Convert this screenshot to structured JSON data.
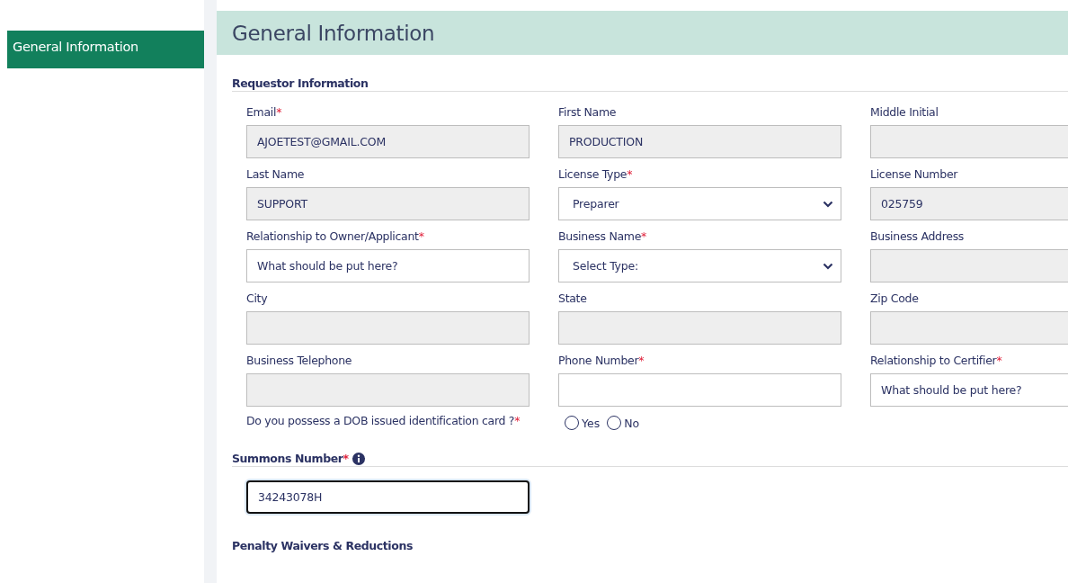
{
  "sidebar": {
    "items": [
      {
        "label": "General Information",
        "selected": true
      }
    ]
  },
  "header": {
    "title": "General Information"
  },
  "requestor": {
    "title": "Requestor Information",
    "fields": [
      {
        "label": "Email",
        "required_mark": "*",
        "kind": "readonly",
        "value": "AJOETEST@GMAIL.COM"
      },
      {
        "label": "First Name",
        "kind": "readonly",
        "value": "PRODUCTION"
      },
      {
        "label": "Middle Initial",
        "kind": "readonly"
      },
      {
        "label": "Last Name",
        "kind": "readonly",
        "value": "SUPPORT"
      },
      {
        "label": "License Type",
        "required_mark": "*",
        "kind": "select",
        "value": "Preparer"
      },
      {
        "label": "License Number",
        "kind": "readonly",
        "value": "025759"
      },
      {
        "label": "Relationship to Owner/Applicant",
        "required_mark": "*",
        "kind": "text",
        "value": "What should be put here?"
      },
      {
        "label": "Business Name",
        "required_mark": "*",
        "kind": "select",
        "value": "Select Type:"
      },
      {
        "label": "Business Address",
        "kind": "readonly"
      },
      {
        "label": "City",
        "kind": "readonly"
      },
      {
        "label": "State",
        "kind": "readonly"
      },
      {
        "label": "Zip Code",
        "kind": "readonly"
      },
      {
        "label": "Business Telephone",
        "kind": "readonly"
      },
      {
        "label": "Phone Number",
        "required_mark": "*",
        "kind": "text"
      },
      {
        "label": "Relationship to Certifier",
        "required_mark": "*",
        "kind": "text",
        "value": "What should be put here?"
      }
    ],
    "question": {
      "label": "Do you possess a DOB issued identification card ?",
      "required_mark": "*",
      "options": [
        {
          "label": "Yes",
          "selected": false
        },
        {
          "label": "No",
          "selected": false
        }
      ]
    }
  },
  "summons": {
    "title": "Summons Number",
    "required_mark": "*",
    "value": "34243078H",
    "focused": true
  },
  "penalty": {
    "title": "Penalty Waivers & Reductions"
  }
}
